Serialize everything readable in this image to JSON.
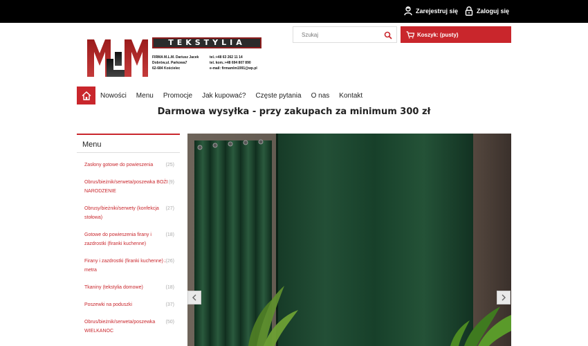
{
  "topbar": {
    "register_label": "Zarejestruj się",
    "login_label": "Zaloguj się"
  },
  "logo": {
    "mark": "MLM",
    "banner_text": "TEKSTYLIA",
    "contact_left": "FIRMA M.L.M. Dariusz Jacek\nDobrów,ul. Parkowa7\n62-684 Kościelec",
    "contact_right": "tel.:+48 63 262 11 14\ntel. kom.:+48 694 807 890\ne-mail: firmamlm1991@wp.pl"
  },
  "search": {
    "placeholder": "Szukaj"
  },
  "cart": {
    "label": "Koszyk: (pusty)"
  },
  "nav": {
    "items": [
      "Nowości",
      "Menu",
      "Promocje",
      "Jak kupować?",
      "Częste pytania",
      "O nas",
      "Kontakt"
    ]
  },
  "promo": {
    "text": "Darmowa wysyłka - przy zakupach za minimum 300 zł"
  },
  "sidebar": {
    "title": "Menu",
    "items": [
      {
        "label": "Zasłony gotowe do powieszenia",
        "count": "(25)"
      },
      {
        "label": "Obrus/bieżnik/serweta/poszewka BOŻE NARODZENIE",
        "count": "(9)"
      },
      {
        "label": "Obrusy/bieżniki/serwety (konfekcja stołowa)",
        "count": "(27)"
      },
      {
        "label": "Gotowe do powieszenia firany i zazdrostki (firanki kuchenne)",
        "count": "(18)"
      },
      {
        "label": "Firany i zazdrostki (firanki kuchenne) z metra",
        "count": "(26)"
      },
      {
        "label": "Tkaniny (tekstylia domowe)",
        "count": "(18)"
      },
      {
        "label": "Poszewki na poduszki",
        "count": "(37)"
      },
      {
        "label": "Obrus/bieżnik/serweta/poszewka WIELKANOC",
        "count": "(50)"
      }
    ]
  },
  "colors": {
    "accent": "#c9262c",
    "topbar": "#000000",
    "curtain": "#1f4a32"
  },
  "icons": {
    "register": "user-add-icon",
    "login": "lock-icon",
    "search": "search-icon",
    "cart": "cart-icon",
    "home": "home-icon",
    "prev": "chevron-left-icon",
    "next": "chevron-right-icon"
  }
}
